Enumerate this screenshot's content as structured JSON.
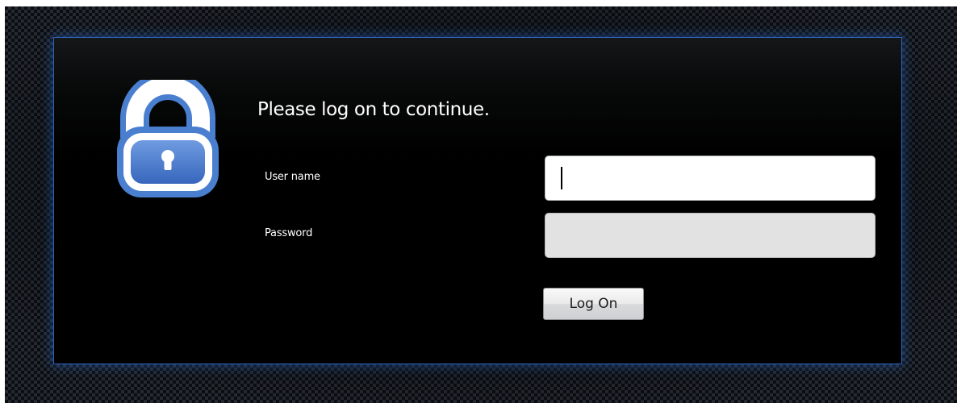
{
  "login": {
    "title": "Please log on to continue.",
    "username_label": "User name",
    "password_label": "Password",
    "username_value": "",
    "password_value": "",
    "logon_label": "Log On"
  },
  "icons": {
    "lock": "lock-icon"
  },
  "colors": {
    "panel_border": "#2f63b8",
    "panel_glow": "#2a6edc",
    "lock_fill": "#4a7fd0",
    "lock_outline": "#ffffff",
    "password_field_bg": "#e1e2e1"
  }
}
